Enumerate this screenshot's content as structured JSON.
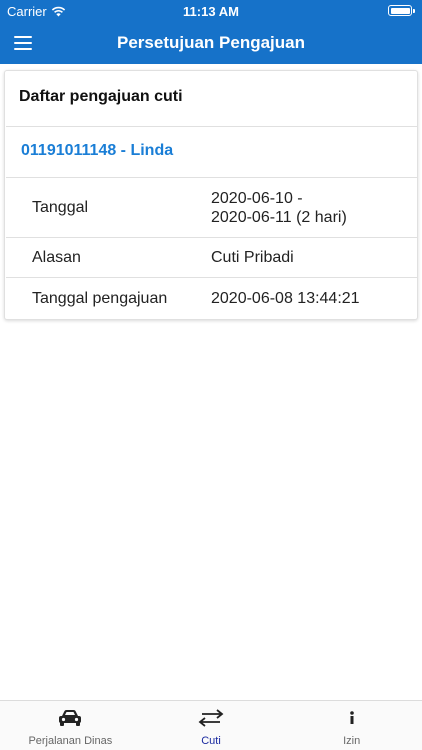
{
  "status_bar": {
    "carrier": "Carrier",
    "time": "11:13 AM"
  },
  "app_bar": {
    "title": "Persetujuan Pengajuan"
  },
  "card": {
    "header": "Daftar pengajuan cuti",
    "request": {
      "title": "01191011148 - Linda",
      "rows": [
        {
          "label": "Tanggal",
          "value_line1": "2020-06-10 -",
          "value_line2": "2020-06-11 (2 hari)"
        },
        {
          "label": "Alasan",
          "value": "Cuti Pribadi"
        },
        {
          "label": "Tanggal pengajuan",
          "value": "2020-06-08 13:44:21"
        }
      ]
    }
  },
  "tabs": [
    {
      "label": "Perjalanan Dinas",
      "icon": "car-icon",
      "active": false
    },
    {
      "label": "Cuti",
      "icon": "swap-arrows-icon",
      "active": true
    },
    {
      "label": "Izin",
      "icon": "info-icon",
      "active": false
    }
  ],
  "colors": {
    "primary": "#1672c9",
    "link": "#1a7ed6",
    "active_tab": "#1a2aa0"
  }
}
